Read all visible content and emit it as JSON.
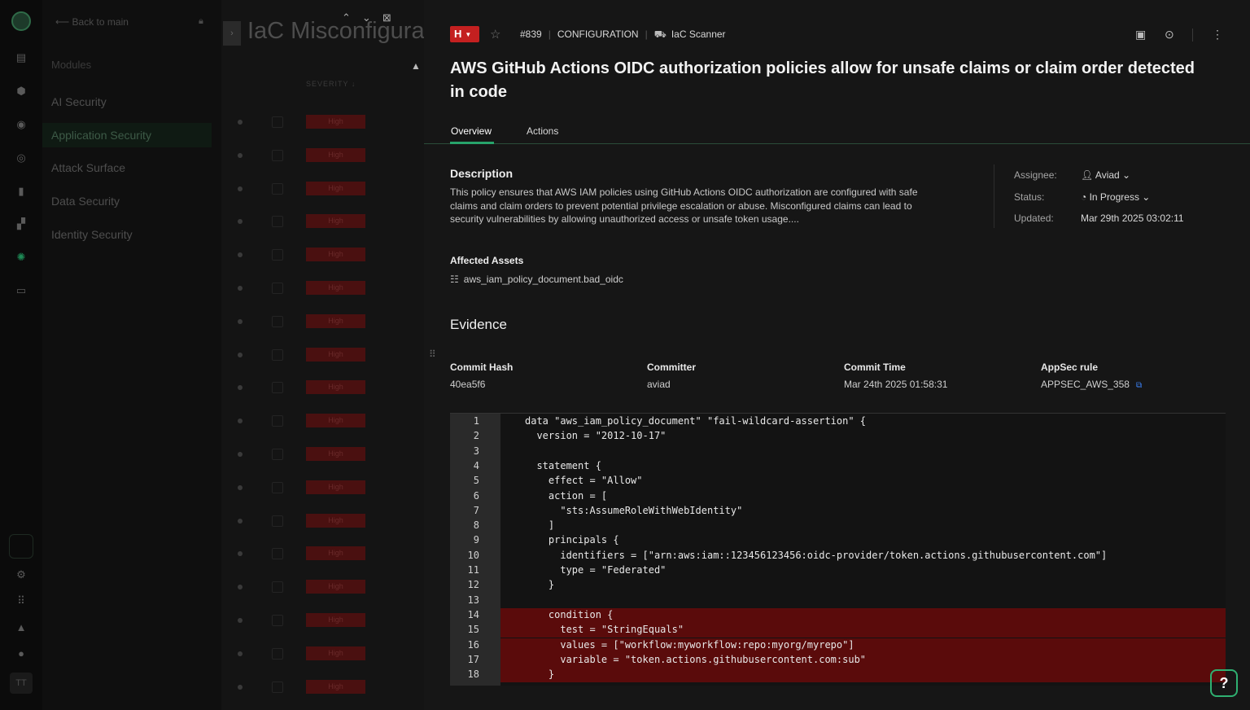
{
  "nav": {
    "back_label": "Back to main",
    "modules_heading": "Modules",
    "items": [
      {
        "label": "AI Security"
      },
      {
        "label": "Application Security"
      },
      {
        "label": "Attack Surface"
      },
      {
        "label": "Data Security"
      },
      {
        "label": "Identity Security"
      }
    ]
  },
  "rail": {
    "user_initials": "TT"
  },
  "list": {
    "title": "IaC Misconfigurat",
    "column_header": "SEVERITY",
    "rows": [
      "High",
      "High",
      "High",
      "High",
      "High",
      "High",
      "High",
      "High",
      "High",
      "High",
      "High",
      "High",
      "High",
      "High",
      "High",
      "High",
      "High",
      "High"
    ]
  },
  "finding": {
    "severity": "H",
    "id": "#839",
    "category": "CONFIGURATION",
    "scanner": "IaC Scanner",
    "title": "AWS GitHub Actions OIDC authorization policies allow for unsafe claims or claim order detected in code",
    "tabs": [
      "Overview",
      "Actions"
    ],
    "description_heading": "Description",
    "description": "This policy ensures that AWS IAM policies using GitHub Actions OIDC authorization are configured with safe claims and claim orders to prevent potential privilege escalation or abuse. Misconfigured claims can lead to security vulnerabilities by allowing unauthorized access or unsafe token usage....",
    "assignee_label": "Assignee:",
    "assignee": "Aviad",
    "status_label": "Status:",
    "status": "In Progress",
    "updated_label": "Updated:",
    "updated": "Mar 29th 2025 03:02:11",
    "affected_assets_heading": "Affected Assets",
    "asset": "aws_iam_policy_document.bad_oidc",
    "evidence_heading": "Evidence",
    "evidence": {
      "commit_hash_label": "Commit Hash",
      "commit_hash": "40ea5f6",
      "committer_label": "Committer",
      "committer": "aviad",
      "commit_time_label": "Commit Time",
      "commit_time": "Mar 24th 2025 01:58:31",
      "rule_label": "AppSec rule",
      "rule": "APPSEC_AWS_358"
    },
    "code": [
      {
        "n": "1",
        "t": "data \"aws_iam_policy_document\" \"fail-wildcard-assertion\" {",
        "hl": false
      },
      {
        "n": "2",
        "t": "  version = \"2012-10-17\"",
        "hl": false
      },
      {
        "n": "3",
        "t": "",
        "hl": false
      },
      {
        "n": "4",
        "t": "  statement {",
        "hl": false
      },
      {
        "n": "5",
        "t": "    effect = \"Allow\"",
        "hl": false
      },
      {
        "n": "6",
        "t": "    action = [",
        "hl": false
      },
      {
        "n": "7",
        "t": "      \"sts:AssumeRoleWithWebIdentity\"",
        "hl": false
      },
      {
        "n": "8",
        "t": "    ]",
        "hl": false
      },
      {
        "n": "9",
        "t": "    principals {",
        "hl": false
      },
      {
        "n": "10",
        "t": "      identifiers = [\"arn:aws:iam::123456123456:oidc-provider/token.actions.githubusercontent.com\"]",
        "hl": false
      },
      {
        "n": "11",
        "t": "      type = \"Federated\"",
        "hl": false
      },
      {
        "n": "12",
        "t": "    }",
        "hl": false
      },
      {
        "n": "13",
        "t": "",
        "hl": false
      },
      {
        "n": "14",
        "t": "    condition {",
        "hl": true
      },
      {
        "n": "15",
        "t": "      test = \"StringEquals\"",
        "hl": true
      },
      {
        "n": "16",
        "t": "      values = [\"workflow:myworkflow:repo:myorg/myrepo\"]",
        "hl": true
      },
      {
        "n": "17",
        "t": "      variable = \"token.actions.githubusercontent.com:sub\"",
        "hl": true
      },
      {
        "n": "18",
        "t": "    }",
        "hl": true
      }
    ]
  },
  "help_label": "?"
}
